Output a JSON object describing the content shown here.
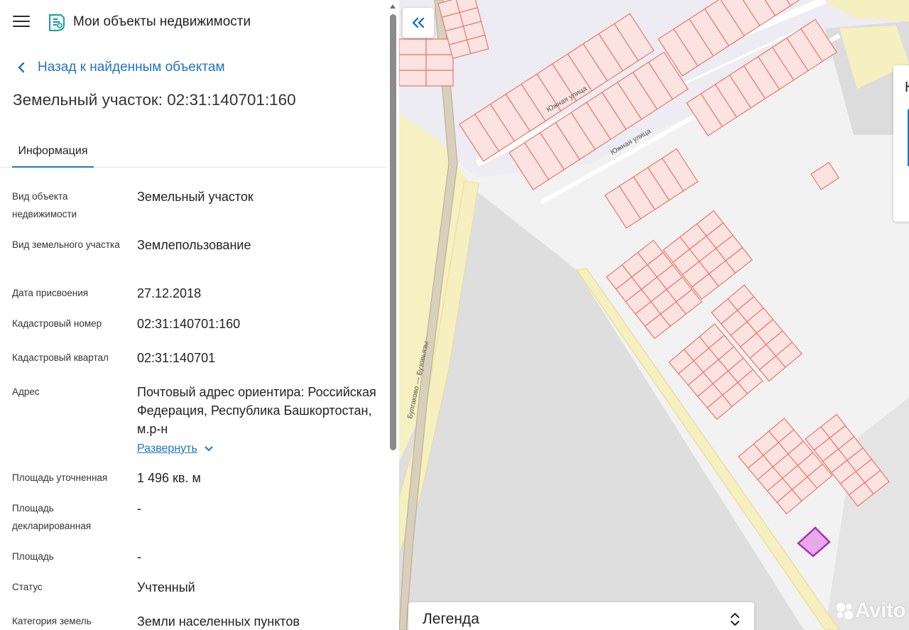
{
  "app": {
    "title": "Мои объекты недвижимости"
  },
  "nav": {
    "back_label": "Назад к найденным объектам"
  },
  "page": {
    "title": "Земельный участок: 02:31:140701:160"
  },
  "tabs": [
    {
      "label": "Информация",
      "active": true
    }
  ],
  "info": [
    {
      "label": "Вид объекта недвижимости",
      "value": "Земельный участок"
    },
    {
      "label": "Вид земельного участка",
      "value": "Землепользование"
    },
    {
      "label": "Дата присвоения",
      "value": "27.12.2018"
    },
    {
      "label": "Кадастровый номер",
      "value": "02:31:140701:160"
    },
    {
      "label": "Кадастровый квартал",
      "value": "02:31:140701"
    },
    {
      "label": "Адрес",
      "value": "Почтовый адрес ориентира: Российская Федерация, Республика Башкортостан, м.р-н",
      "expand_label": "Развернуть"
    },
    {
      "label": "Площадь уточненная",
      "value": "1 496 кв. м"
    },
    {
      "label": "Площадь декларированная",
      "value": "-"
    },
    {
      "label": "Площадь",
      "value": "-"
    },
    {
      "label": "Статус",
      "value": "Учтенный"
    },
    {
      "label": "Категория земель",
      "value": "Земли населенных пунктов"
    }
  ],
  "map": {
    "street_labels": [
      "Южная улица",
      "Южная улица",
      "Булгаково — Бузовьязы"
    ],
    "legend_title": "Легенда",
    "side_card_letter": "К",
    "watermark": "Avito",
    "colors": {
      "accent": "#1f73c9",
      "parcel_stroke": "#e8796c",
      "parcel_fill": "#fbe3e1",
      "selected_parcel": "#a434b8",
      "road": "#f6f0c2"
    }
  }
}
